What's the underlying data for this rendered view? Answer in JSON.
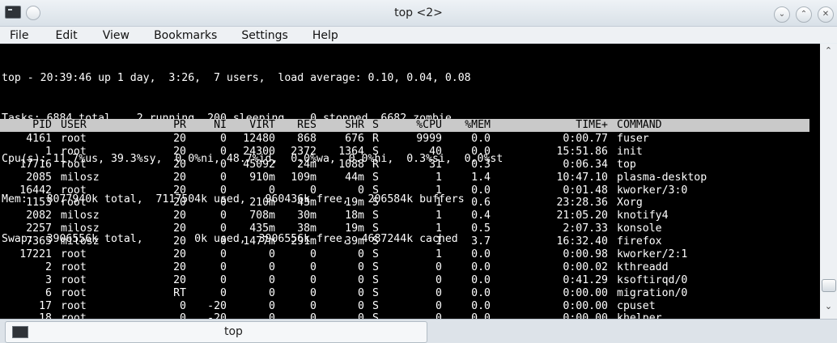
{
  "window": {
    "title": "top <2>"
  },
  "menu": [
    "File",
    "Edit",
    "View",
    "Bookmarks",
    "Settings",
    "Help"
  ],
  "summary": [
    "top - 20:39:46 up 1 day,  3:26,  7 users,  load average: 0.10, 0.04, 0.08",
    "Tasks: 6884 total,   2 running, 200 sleeping,   0 stopped, 6682 zombie",
    "Cpu(s): 11.7%us, 39.3%sy,  0.0%ni, 48.7%id,  0.0%wa,  0.0%hi,  0.3%si,  0.0%st",
    "Mem:   8077940k total,  7117504k used,   960436k free,   206584k buffers",
    "Swap:  3906556k total,        0k used,  3906556k free,  4687244k cached"
  ],
  "columns": {
    "pid": "PID",
    "user": "USER",
    "pr": "PR",
    "ni": "NI",
    "virt": "VIRT",
    "res": "RES",
    "shr": "SHR",
    "s": "S",
    "cpu": "%CPU",
    "mem": "%MEM",
    "time": "TIME+",
    "cmd": "COMMAND"
  },
  "processes": [
    {
      "pid": "4161",
      "user": "root",
      "pr": "20",
      "ni": "0",
      "virt": "12480",
      "res": "868",
      "shr": "676",
      "s": "R",
      "cpu": "9999",
      "mem": "0.0",
      "time": "0:00.77",
      "cmd": "fuser"
    },
    {
      "pid": "1",
      "user": "root",
      "pr": "20",
      "ni": "0",
      "virt": "24300",
      "res": "2372",
      "shr": "1364",
      "s": "S",
      "cpu": "40",
      "mem": "0.0",
      "time": "15:51.86",
      "cmd": "init"
    },
    {
      "pid": "17716",
      "user": "root",
      "pr": "20",
      "ni": "0",
      "virt": "45092",
      "res": "24m",
      "shr": "1088",
      "s": "R",
      "cpu": "31",
      "mem": "0.3",
      "time": "0:06.34",
      "cmd": "top"
    },
    {
      "pid": "2085",
      "user": "milosz",
      "pr": "20",
      "ni": "0",
      "virt": "910m",
      "res": "109m",
      "shr": "44m",
      "s": "S",
      "cpu": "1",
      "mem": "1.4",
      "time": "10:47.10",
      "cmd": "plasma-desktop"
    },
    {
      "pid": "16442",
      "user": "root",
      "pr": "20",
      "ni": "0",
      "virt": "0",
      "res": "0",
      "shr": "0",
      "s": "S",
      "cpu": "1",
      "mem": "0.0",
      "time": "0:01.48",
      "cmd": "kworker/3:0"
    },
    {
      "pid": "1153",
      "user": "root",
      "pr": "20",
      "ni": "0",
      "virt": "210m",
      "res": "43m",
      "shr": "19m",
      "s": "S",
      "cpu": "1",
      "mem": "0.6",
      "time": "23:28.36",
      "cmd": "Xorg"
    },
    {
      "pid": "2082",
      "user": "milosz",
      "pr": "20",
      "ni": "0",
      "virt": "708m",
      "res": "30m",
      "shr": "18m",
      "s": "S",
      "cpu": "1",
      "mem": "0.4",
      "time": "21:05.20",
      "cmd": "knotify4"
    },
    {
      "pid": "2257",
      "user": "milosz",
      "pr": "20",
      "ni": "0",
      "virt": "435m",
      "res": "38m",
      "shr": "19m",
      "s": "S",
      "cpu": "1",
      "mem": "0.5",
      "time": "2:07.33",
      "cmd": "konsole"
    },
    {
      "pid": "7365",
      "user": "milosz",
      "pr": "20",
      "ni": "0",
      "virt": "1477m",
      "res": "291m",
      "shr": "39m",
      "s": "S",
      "cpu": "1",
      "mem": "3.7",
      "time": "16:32.40",
      "cmd": "firefox"
    },
    {
      "pid": "17221",
      "user": "root",
      "pr": "20",
      "ni": "0",
      "virt": "0",
      "res": "0",
      "shr": "0",
      "s": "S",
      "cpu": "1",
      "mem": "0.0",
      "time": "0:00.98",
      "cmd": "kworker/2:1"
    },
    {
      "pid": "2",
      "user": "root",
      "pr": "20",
      "ni": "0",
      "virt": "0",
      "res": "0",
      "shr": "0",
      "s": "S",
      "cpu": "0",
      "mem": "0.0",
      "time": "0:00.02",
      "cmd": "kthreadd"
    },
    {
      "pid": "3",
      "user": "root",
      "pr": "20",
      "ni": "0",
      "virt": "0",
      "res": "0",
      "shr": "0",
      "s": "S",
      "cpu": "0",
      "mem": "0.0",
      "time": "0:41.29",
      "cmd": "ksoftirqd/0"
    },
    {
      "pid": "6",
      "user": "root",
      "pr": "RT",
      "ni": "0",
      "virt": "0",
      "res": "0",
      "shr": "0",
      "s": "S",
      "cpu": "0",
      "mem": "0.0",
      "time": "0:00.00",
      "cmd": "migration/0"
    },
    {
      "pid": "17",
      "user": "root",
      "pr": "0",
      "ni": "-20",
      "virt": "0",
      "res": "0",
      "shr": "0",
      "s": "S",
      "cpu": "0",
      "mem": "0.0",
      "time": "0:00.00",
      "cmd": "cpuset"
    },
    {
      "pid": "18",
      "user": "root",
      "pr": "0",
      "ni": "-20",
      "virt": "0",
      "res": "0",
      "shr": "0",
      "s": "S",
      "cpu": "0",
      "mem": "0.0",
      "time": "0:00.00",
      "cmd": "khelper"
    }
  ],
  "tab": {
    "label": "top"
  },
  "icons": {
    "app": "terminal-icon",
    "sticky": "pin-icon",
    "minimize": "chevron-down-icon",
    "maximize": "chevron-up-icon",
    "close": "close-icon"
  }
}
